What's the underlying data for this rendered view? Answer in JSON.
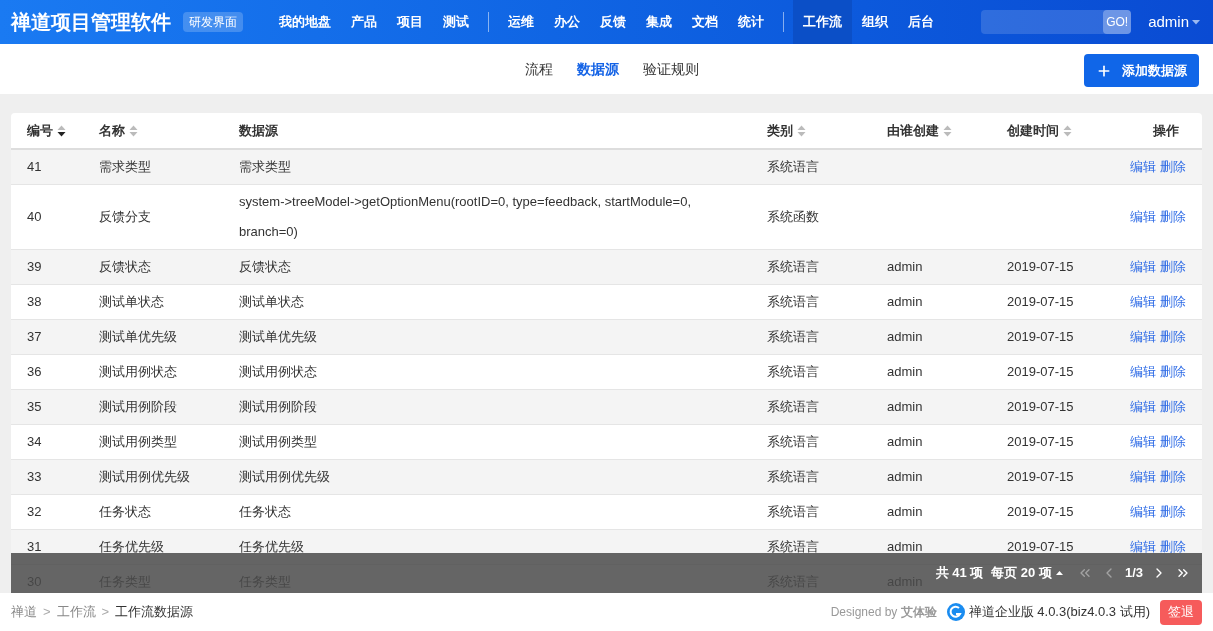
{
  "header": {
    "brand": "禅道项目管理软件",
    "mode_badge": "研发界面",
    "nav_groups": [
      [
        {
          "label": "我的地盘",
          "selected": false
        },
        {
          "label": "产品",
          "selected": false
        },
        {
          "label": "项目",
          "selected": false
        },
        {
          "label": "测试",
          "selected": false
        }
      ],
      [
        {
          "label": "运维",
          "selected": false
        },
        {
          "label": "办公",
          "selected": false
        },
        {
          "label": "反馈",
          "selected": false
        },
        {
          "label": "集成",
          "selected": false
        },
        {
          "label": "文档",
          "selected": false
        },
        {
          "label": "统计",
          "selected": false
        }
      ],
      [
        {
          "label": "工作流",
          "selected": true
        },
        {
          "label": "组织",
          "selected": false
        },
        {
          "label": "后台",
          "selected": false
        }
      ]
    ],
    "search_button": "GO!",
    "user": "admin"
  },
  "subnav": {
    "tabs": [
      {
        "label": "流程",
        "selected": false
      },
      {
        "label": "数据源",
        "selected": true
      },
      {
        "label": "验证规则",
        "selected": false
      }
    ],
    "add_button": "添加数据源"
  },
  "table": {
    "columns": [
      {
        "label": "编号",
        "sortable": true,
        "sorted_desc": true
      },
      {
        "label": "名称",
        "sortable": true,
        "sorted_desc": false
      },
      {
        "label": "数据源",
        "sortable": false
      },
      {
        "label": "类别",
        "sortable": true,
        "sorted_desc": false
      },
      {
        "label": "由谁创建",
        "sortable": true,
        "sorted_desc": false
      },
      {
        "label": "创建时间",
        "sortable": true,
        "sorted_desc": false
      },
      {
        "label": "操作",
        "sortable": false
      }
    ],
    "rows": [
      {
        "id": "41",
        "name": "需求类型",
        "source": "需求类型",
        "category": "系统语言",
        "actions": [
          "编辑",
          "删除"
        ]
      },
      {
        "id": "40",
        "name": "反馈分支",
        "source": "system->treeModel->getOptionMenu(rootID=0, type=feedback, startModule=0, branch=0)",
        "category": "系统函数",
        "actions": [
          "编辑",
          "删除"
        ]
      },
      {
        "id": "39",
        "name": "反馈状态",
        "source": "反馈状态",
        "category": "系统语言",
        "created_by": "admin",
        "created_at": "2019-07-15",
        "actions": [
          "编辑",
          "删除"
        ]
      },
      {
        "id": "38",
        "name": "测试单状态",
        "source": "测试单状态",
        "category": "系统语言",
        "created_by": "admin",
        "created_at": "2019-07-15",
        "actions": [
          "编辑",
          "删除"
        ]
      },
      {
        "id": "37",
        "name": "测试单优先级",
        "source": "测试单优先级",
        "category": "系统语言",
        "created_by": "admin",
        "created_at": "2019-07-15",
        "actions": [
          "编辑",
          "删除"
        ]
      },
      {
        "id": "36",
        "name": "测试用例状态",
        "source": "测试用例状态",
        "category": "系统语言",
        "created_by": "admin",
        "created_at": "2019-07-15",
        "actions": [
          "编辑",
          "删除"
        ]
      },
      {
        "id": "35",
        "name": "测试用例阶段",
        "source": "测试用例阶段",
        "category": "系统语言",
        "created_by": "admin",
        "created_at": "2019-07-15",
        "actions": [
          "编辑",
          "删除"
        ]
      },
      {
        "id": "34",
        "name": "测试用例类型",
        "source": "测试用例类型",
        "category": "系统语言",
        "created_by": "admin",
        "created_at": "2019-07-15",
        "actions": [
          "编辑",
          "删除"
        ]
      },
      {
        "id": "33",
        "name": "测试用例优先级",
        "source": "测试用例优先级",
        "category": "系统语言",
        "created_by": "admin",
        "created_at": "2019-07-15",
        "actions": [
          "编辑",
          "删除"
        ]
      },
      {
        "id": "32",
        "name": "任务状态",
        "source": "任务状态",
        "category": "系统语言",
        "created_by": "admin",
        "created_at": "2019-07-15",
        "actions": [
          "编辑",
          "删除"
        ]
      },
      {
        "id": "31",
        "name": "任务优先级",
        "source": "任务优先级",
        "category": "系统语言",
        "created_by": "admin",
        "created_at": "2019-07-15",
        "actions": [
          "编辑",
          "删除"
        ]
      },
      {
        "id": "30",
        "name": "任务类型",
        "source": "任务类型",
        "category": "系统语言",
        "created_by": "admin"
      }
    ]
  },
  "pager": {
    "total": "共 41 项",
    "per_page": "每页 20 项",
    "page": "1/3",
    "first_disabled": true,
    "prev_disabled": true,
    "next_disabled": false,
    "last_disabled": false
  },
  "footer": {
    "breadcrumb": [
      "禅道",
      "工作流",
      "工作流数据源"
    ],
    "breadcrumb_separator": ">",
    "designed_by": "Designed by **艾体验**",
    "version": "禅道企业版 4.0.3(biz4.0.3 试用)",
    "logout_button": "签退"
  }
}
